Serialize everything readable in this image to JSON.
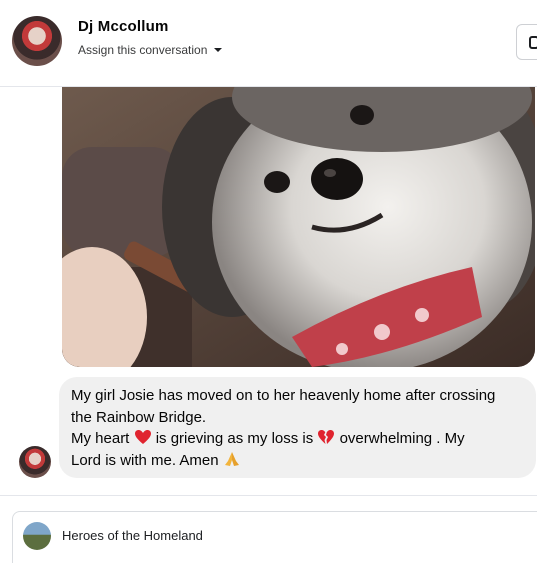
{
  "header": {
    "contact_name": "Dj Mccollum",
    "assign_label": "Assign this conversation"
  },
  "message": {
    "line1": "My girl Josie has moved on to her heavenly home after crossing",
    "line2": "the Rainbow Bridge.",
    "line3_part1": "My heart",
    "line3_part2": "is grieving as my loss is",
    "line3_part3": "overwhelming .  My",
    "line4": "Lord is with me.  Amen"
  },
  "page_row": {
    "name": "Heroes of the Homeland"
  },
  "icons": {
    "caret": "chevron-down-icon",
    "heart": "red-heart-emoji",
    "broken_heart": "broken-heart-emoji",
    "pray": "folded-hands-emoji",
    "header_button": "info-icon"
  },
  "colors": {
    "bubble": "#f0f0f0",
    "divider": "#e4e6eb",
    "text": "#050505"
  }
}
